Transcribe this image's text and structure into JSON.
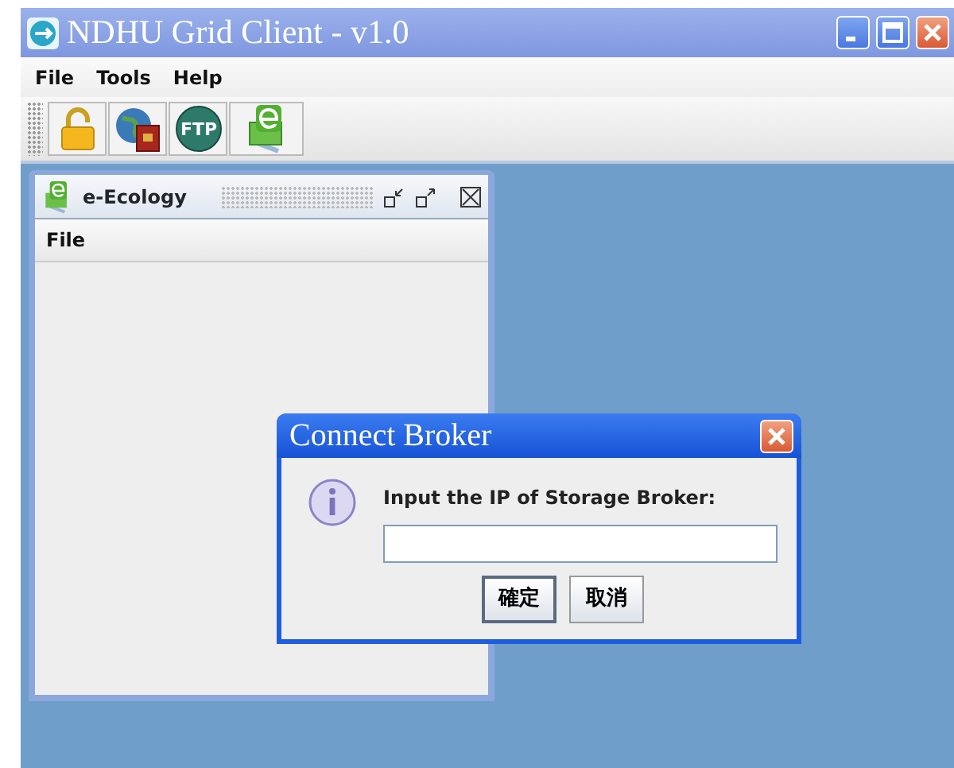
{
  "window": {
    "title": "NDHU Grid Client - v1.0"
  },
  "menu": [
    {
      "label": "File"
    },
    {
      "label": "Tools"
    },
    {
      "label": "Help"
    }
  ],
  "toolbar": [
    {
      "kind": "lock"
    },
    {
      "kind": "globe"
    },
    {
      "kind": "ftp",
      "label": "FTP"
    },
    {
      "kind": "ecology"
    }
  ],
  "internal_frame": {
    "title": "e-Ecology",
    "menu": [
      {
        "label": "File"
      }
    ]
  },
  "dialog": {
    "title": "Connect Broker",
    "message": "Input the IP of Storage Broker:",
    "buttons": [
      {
        "label": "確定",
        "default": true
      },
      {
        "label": "取消",
        "default": false
      }
    ]
  }
}
